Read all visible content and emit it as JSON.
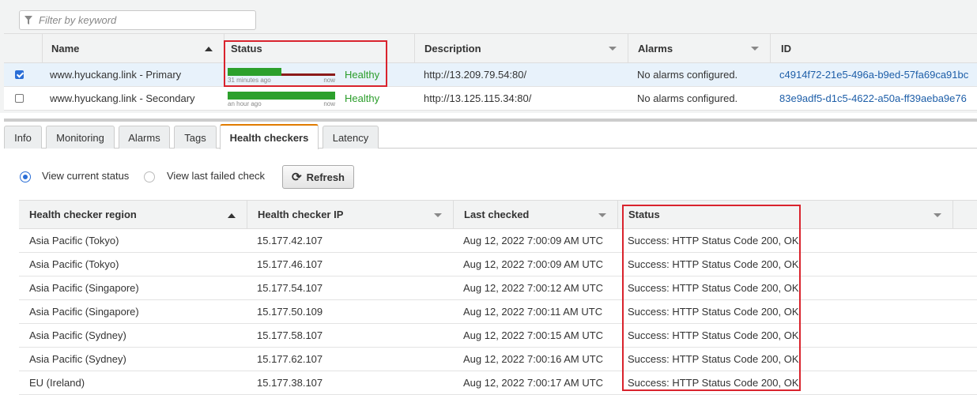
{
  "filter": {
    "placeholder": "Filter by keyword"
  },
  "grid": {
    "columns": {
      "name": "Name",
      "status": "Status",
      "description": "Description",
      "alarms": "Alarms",
      "id": "ID"
    },
    "rows": [
      {
        "checked": true,
        "name": "www.hyuckang.link - Primary",
        "chart_left_label": "31 minutes ago",
        "chart_right_label": "now",
        "status": "Healthy",
        "description": "http://13.209.79.54:80/",
        "alarms": "No alarms configured.",
        "id": "c4914f72-21e5-496a-b9ed-57fa69ca91bc"
      },
      {
        "checked": false,
        "name": "www.hyuckang.link - Secondary",
        "chart_left_label": "an hour ago",
        "chart_right_label": "now",
        "status": "Healthy",
        "description": "http://13.125.115.34:80/",
        "alarms": "No alarms configured.",
        "id": "83e9adf5-d1c5-4622-a50a-ff39aeba9e76"
      }
    ]
  },
  "tabs": [
    "Info",
    "Monitoring",
    "Alarms",
    "Tags",
    "Health checkers",
    "Latency"
  ],
  "active_tab": "Health checkers",
  "view": {
    "current_label": "View current status",
    "failed_label": "View last failed check",
    "refresh_label": "Refresh",
    "selected": "current"
  },
  "health_checkers": {
    "columns": {
      "region": "Health checker region",
      "ip": "Health checker IP",
      "last_checked": "Last checked",
      "status": "Status"
    },
    "rows": [
      {
        "region": "Asia Pacific (Tokyo)",
        "ip": "15.177.42.107",
        "last_checked": "Aug 12, 2022 7:00:09 AM UTC",
        "status": "Success: HTTP Status Code 200, OK"
      },
      {
        "region": "Asia Pacific (Tokyo)",
        "ip": "15.177.46.107",
        "last_checked": "Aug 12, 2022 7:00:09 AM UTC",
        "status": "Success: HTTP Status Code 200, OK"
      },
      {
        "region": "Asia Pacific (Singapore)",
        "ip": "15.177.54.107",
        "last_checked": "Aug 12, 2022 7:00:12 AM UTC",
        "status": "Success: HTTP Status Code 200, OK"
      },
      {
        "region": "Asia Pacific (Singapore)",
        "ip": "15.177.50.109",
        "last_checked": "Aug 12, 2022 7:00:11 AM UTC",
        "status": "Success: HTTP Status Code 200, OK"
      },
      {
        "region": "Asia Pacific (Sydney)",
        "ip": "15.177.58.107",
        "last_checked": "Aug 12, 2022 7:00:15 AM UTC",
        "status": "Success: HTTP Status Code 200, OK"
      },
      {
        "region": "Asia Pacific (Sydney)",
        "ip": "15.177.62.107",
        "last_checked": "Aug 12, 2022 7:00:16 AM UTC",
        "status": "Success: HTTP Status Code 200, OK"
      },
      {
        "region": "EU (Ireland)",
        "ip": "15.177.38.107",
        "last_checked": "Aug 12, 2022 7:00:17 AM UTC",
        "status": "Success: HTTP Status Code 200, OK"
      }
    ]
  },
  "colors": {
    "accent": "#2a6ed6",
    "healthy": "#2a9d2a",
    "highlight": "#d9232d",
    "active_tab": "#e07b00"
  }
}
